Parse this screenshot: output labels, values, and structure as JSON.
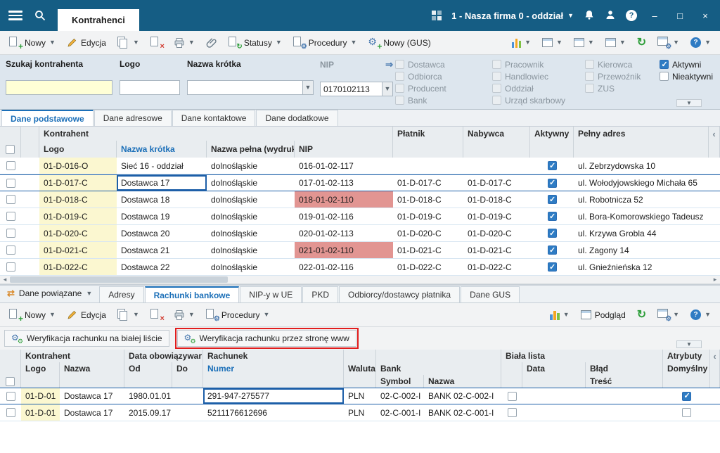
{
  "colors": {
    "topbar": "#155d84",
    "accent": "#1b6fb8",
    "alert": "#e29592",
    "check": "#2e7cc4",
    "inputy": "#ffffd6",
    "celly": "#fbf7d0",
    "sel": "#1d5fa8",
    "annot": "#e11d1d",
    "green": "#2e9e3a",
    "red": "#d23b30"
  },
  "topbar": {
    "tab": "Kontrahenci",
    "company": "1 - Nasza firma 0 - oddział",
    "min": "–",
    "max": "□",
    "close": "×"
  },
  "toolbar": {
    "nowy": "Nowy",
    "edycja": "Edycja",
    "statusy": "Statusy",
    "procedury": "Procedury",
    "nowy_gus": "Nowy (GUS)"
  },
  "filter": {
    "szukaj": "Szukaj kontrahenta",
    "logo": "Logo",
    "nazwa_krotka": "Nazwa krótka",
    "nip": "NIP",
    "nip_value": "0170102113",
    "col1": [
      "Dostawca",
      "Odbiorca",
      "Producent",
      "Bank"
    ],
    "col2": [
      "Pracownik",
      "Handlowiec",
      "Oddział",
      "Urząd skarbowy"
    ],
    "col3": [
      "Kierowca",
      "Przewoźnik",
      "ZUS"
    ],
    "aktywni": "Aktywni",
    "nieaktywni": "Nieaktywni"
  },
  "tabs_main": [
    "Dane podstawowe",
    "Dane adresowe",
    "Dane kontaktowe",
    "Dane dodatkowe"
  ],
  "grid": {
    "group": "Kontrahent",
    "headers": {
      "logo": "Logo",
      "nazwa": "Nazwa krótka",
      "pelna": "Nazwa pełna (wydruki)",
      "nip": "NIP",
      "platnik": "Płatnik",
      "nabywca": "Nabywca",
      "aktywny": "Aktywny",
      "adres": "Pełny adres"
    },
    "rows": [
      {
        "logo": "01-D-016-O",
        "nazwa": "Sieć 16 - oddział",
        "pelna": "dolnośląskie",
        "nip": "016-01-02-117",
        "platnik": "",
        "nabywca": "",
        "aktywny": true,
        "adres": "ul. Zebrzydowska 10"
      },
      {
        "logo": "01-D-017-C",
        "nazwa": "Dostawca 17",
        "pelna": "dolnośląskie",
        "nip": "017-01-02-113",
        "platnik": "01-D-017-C",
        "nabywca": "01-D-017-C",
        "aktywny": true,
        "adres": "ul. Wołodyjowskiego Michała 65",
        "selected": true,
        "focused": true
      },
      {
        "logo": "01-D-018-C",
        "nazwa": "Dostawca 18",
        "pelna": "dolnośląskie",
        "nip": "018-01-02-110",
        "nip_alert": true,
        "platnik": "01-D-018-C",
        "nabywca": "01-D-018-C",
        "aktywny": true,
        "adres": "ul. Robotnicza 52"
      },
      {
        "logo": "01-D-019-C",
        "nazwa": "Dostawca 19",
        "pelna": "dolnośląskie",
        "nip": "019-01-02-116",
        "platnik": "01-D-019-C",
        "nabywca": "01-D-019-C",
        "aktywny": true,
        "adres": "ul. Bora-Komorowskiego Tadeusz"
      },
      {
        "logo": "01-D-020-C",
        "nazwa": "Dostawca 20",
        "pelna": "dolnośląskie",
        "nip": "020-01-02-113",
        "platnik": "01-D-020-C",
        "nabywca": "01-D-020-C",
        "aktywny": true,
        "adres": "ul. Krzywa Grobla 44"
      },
      {
        "logo": "01-D-021-C",
        "nazwa": "Dostawca 21",
        "pelna": "dolnośląskie",
        "nip": "021-01-02-110",
        "nip_alert": true,
        "platnik": "01-D-021-C",
        "nabywca": "01-D-021-C",
        "aktywny": true,
        "adres": "ul. Zagony 14"
      },
      {
        "logo": "01-D-022-C",
        "nazwa": "Dostawca 22",
        "pelna": "dolnośląskie",
        "nip": "022-01-02-116",
        "platnik": "01-D-022-C",
        "nabywca": "01-D-022-C",
        "aktywny": true,
        "adres": "ul. Gnieźnieńska 12"
      }
    ]
  },
  "related": {
    "title": "Dane powiązane",
    "tabs": [
      "Adresy",
      "Rachunki bankowe",
      "NIP-y w UE",
      "PKD",
      "Odbiorcy/dostawcy płatnika",
      "Dane GUS"
    ],
    "podglad": "Podgląd",
    "verify_white_list": "Weryfikacja rachunku na białej liście",
    "verify_www": "Weryfikacja rachunku przez stronę www"
  },
  "bgrid": {
    "groups": {
      "kontrahent": "Kontrahent",
      "data_obow": "Data obowiązywar",
      "rachunek": "Rachunek",
      "biala": "Biała lista",
      "atrybuty": "Atrybuty"
    },
    "headers": {
      "logo": "Logo",
      "nazwa": "Nazwa",
      "od": "Od",
      "do": "Do",
      "numer": "Numer",
      "waluta": "Waluta",
      "bank": "Bank",
      "symbol": "Symbol",
      "bnazwa": "Nazwa",
      "data": "Data",
      "blad": "Błąd",
      "tresc": "Treść",
      "domyslny": "Domyślny"
    },
    "rows": [
      {
        "logo": "01-D-01",
        "nazwa": "Dostawca 17",
        "od": "1980.01.01",
        "do": "",
        "numer": "291-947-275577",
        "waluta": "PLN",
        "symbol": "02-C-002-I",
        "bank": "BANK 02-C-002-I",
        "domyslny": true,
        "selected": true,
        "focused": true
      },
      {
        "logo": "01-D-01",
        "nazwa": "Dostawca 17",
        "od": "2015.09.17",
        "do": "",
        "numer": "5211176612696",
        "waluta": "PLN",
        "symbol": "02-C-001-I",
        "bank": "BANK 02-C-001-I",
        "domyslny": false
      }
    ]
  }
}
